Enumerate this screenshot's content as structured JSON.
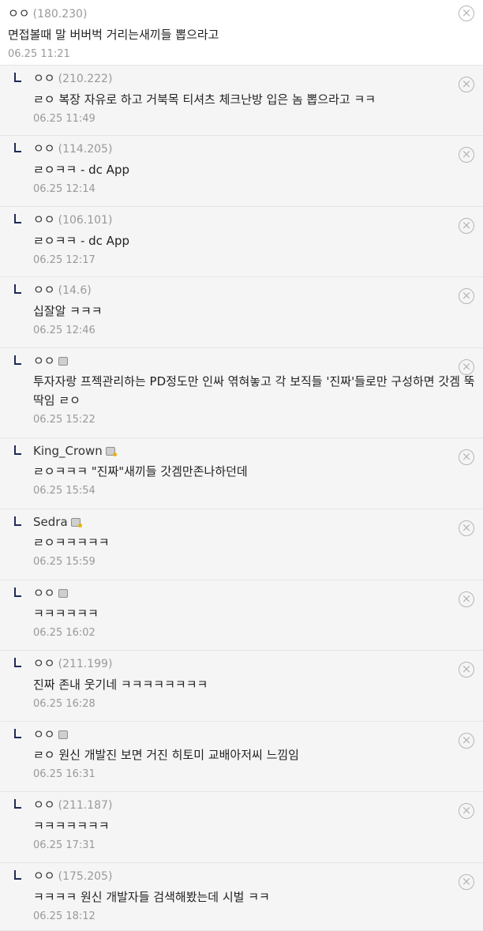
{
  "top_comment": {
    "nick": "ㅇㅇ",
    "ip": "(180.230)",
    "text": "면접볼때 말 버버벅 거리는새끼들 뽑으라고",
    "date": "06.25 11:21"
  },
  "replies": [
    {
      "nick": "ㅇㅇ",
      "ip": "(210.222)",
      "icon": "",
      "text": "ㄹㅇ 복장 자유로 하고 거북목 티셔츠 체크난방 입은 놈 뽑으라고 ㅋㅋ",
      "date": "06.25 11:49"
    },
    {
      "nick": "ㅇㅇ",
      "ip": "(114.205)",
      "icon": "",
      "text": "ㄹㅇㅋㅋ - dc App",
      "date": "06.25 12:14"
    },
    {
      "nick": "ㅇㅇ",
      "ip": "(106.101)",
      "icon": "",
      "text": "ㄹㅇㅋㅋ - dc App",
      "date": "06.25 12:17"
    },
    {
      "nick": "ㅇㅇ",
      "ip": "(14.6)",
      "icon": "",
      "text": "십잘알 ㅋㅋㅋ",
      "date": "06.25 12:46"
    },
    {
      "nick": "ㅇㅇ",
      "ip": "",
      "icon": "member-icon",
      "text": "투자자랑 프젝관리하는 PD정도만 인싸 엮혀놓고 각 보직들 '진짜'들로만 구성하면 갓겜 뚝딱임 ㄹㅇ",
      "date": "06.25 15:22"
    },
    {
      "nick": "King_Crown",
      "ip": "",
      "icon": "gold-member-icon",
      "text": "ㄹㅇㅋㅋㅋ \"진짜\"새끼들 갓겜만존나하던데",
      "date": "06.25 15:54"
    },
    {
      "nick": "Sedra",
      "ip": "",
      "icon": "gold-member-icon",
      "text": "ㄹㅇㅋㅋㅋㅋㅋ",
      "date": "06.25 15:59"
    },
    {
      "nick": "ㅇㅇ",
      "ip": "",
      "icon": "member-icon",
      "text": "ㅋㅋㅋㅋㅋㅋ",
      "date": "06.25 16:02"
    },
    {
      "nick": "ㅇㅇ",
      "ip": "(211.199)",
      "icon": "",
      "text": "진짜 존내 웃기네 ㅋㅋㅋㅋㅋㅋㅋㅋ",
      "date": "06.25 16:28"
    },
    {
      "nick": "ㅇㅇ",
      "ip": "",
      "icon": "member-icon",
      "text": "ㄹㅇ 원신 개발진 보면 거진 히토미 교배아저씨 느낌임",
      "date": "06.25 16:31"
    },
    {
      "nick": "ㅇㅇ",
      "ip": "(211.187)",
      "icon": "",
      "text": "ㅋㅋㅋㅋㅋㅋㅋ",
      "date": "06.25 17:31"
    },
    {
      "nick": "ㅇㅇ",
      "ip": "(175.205)",
      "icon": "",
      "text": "ㅋㅋㅋㅋ 원신 개발자들 검색해봤는데 시벌 ㅋㅋ",
      "date": "06.25 18:12"
    }
  ],
  "icons": {
    "delete": "close-circle-icon",
    "reply": "reply-corner-icon"
  },
  "delete_glyph": "×"
}
